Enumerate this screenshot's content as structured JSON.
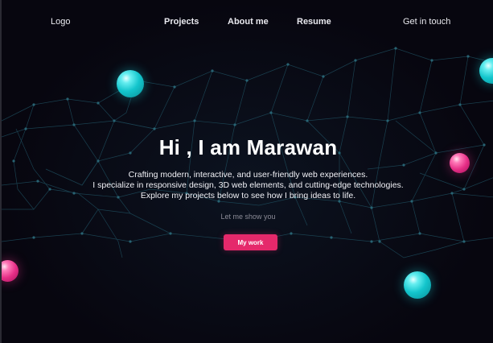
{
  "nav": {
    "logo": "Logo",
    "links": [
      "Projects",
      "About me",
      "Resume"
    ],
    "cta": "Get in touch"
  },
  "hero": {
    "title": "Hi , I am Marawan",
    "description": [
      "Crafting modern, interactive, and user-friendly web experiences.",
      "I specialize in responsive design, 3D web elements, and cutting-edge technologies.",
      "Explore my projects below to see how I bring ideas to life."
    ],
    "subtext": "Let me show you",
    "button": "My work"
  },
  "colors": {
    "background": "#07060f",
    "accent": "#e5296b",
    "cyan": "#13c5cc",
    "network": "#1f4a5a"
  }
}
